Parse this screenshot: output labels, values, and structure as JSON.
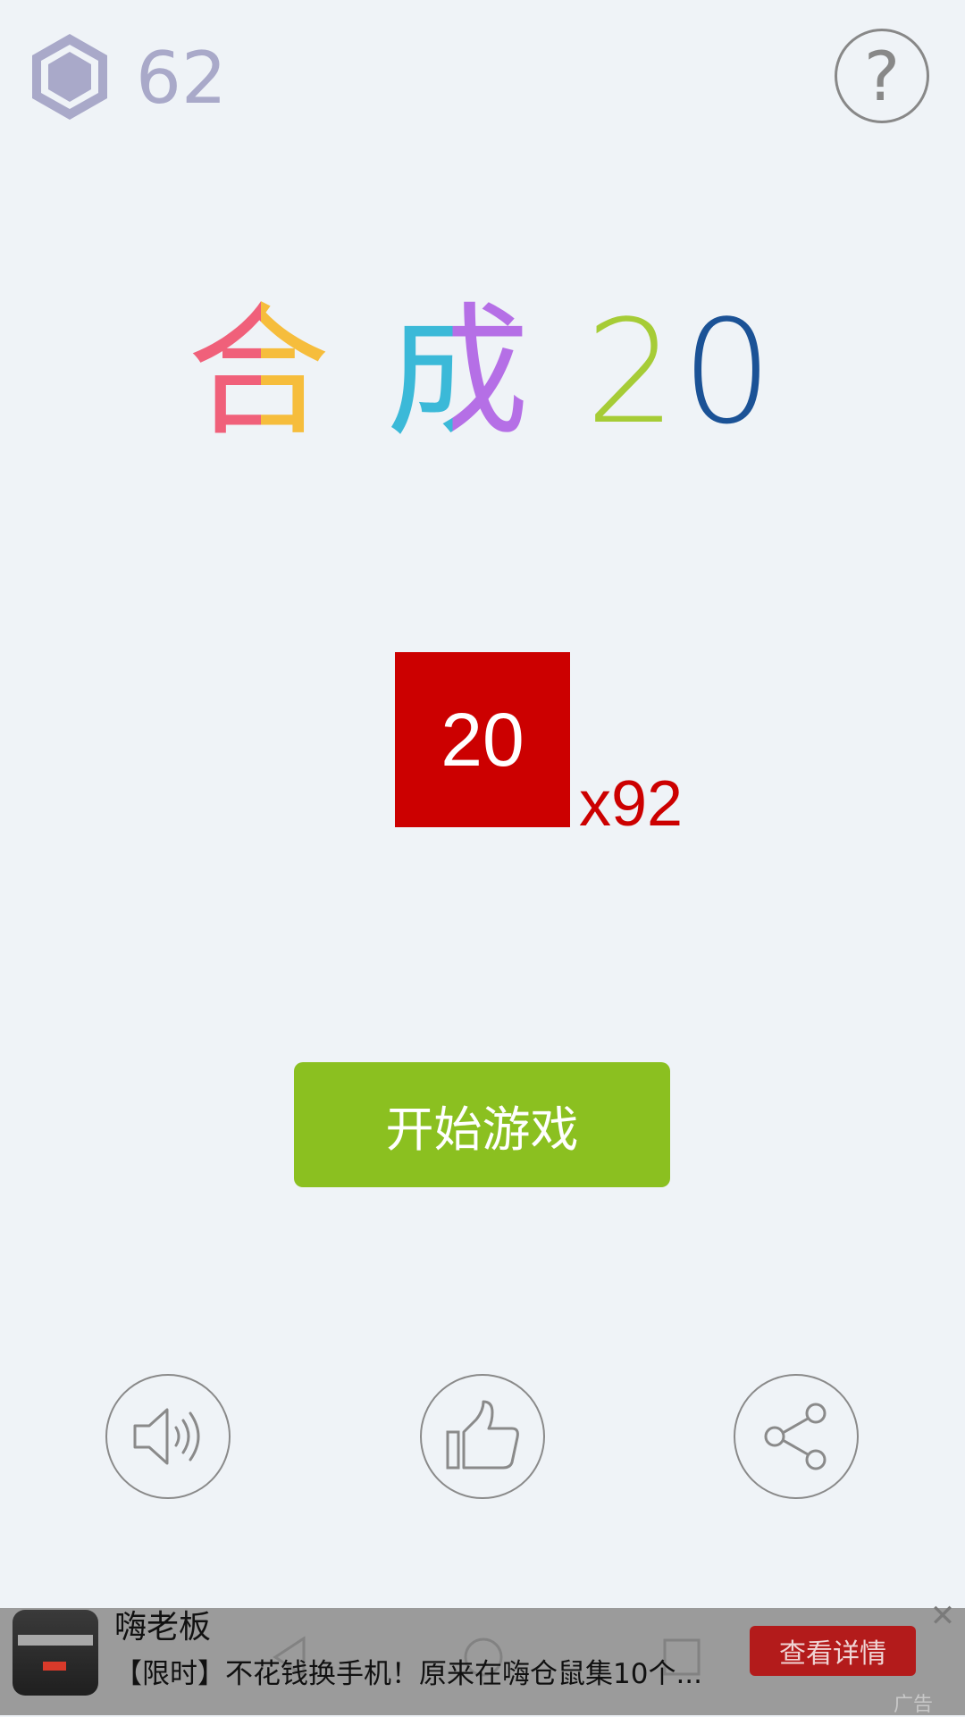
{
  "top_bar": {
    "gem_icon": "hexagon-gem-icon",
    "gem_count": "62",
    "help_label": "?"
  },
  "title": {
    "chars": [
      "合",
      "成",
      "2",
      "0"
    ],
    "colors": {
      "he_left": "#f0607a",
      "he_right": "#f6bd3c",
      "cheng_left": "#3bb9d8",
      "cheng_right": "#b56fe6",
      "two": "#a6cc36",
      "zero": "#1b5296"
    }
  },
  "tile": {
    "value": "20",
    "multiplier": "x92",
    "color": "#cc0000"
  },
  "start_button": {
    "label": "开始游戏",
    "color": "#8bc020"
  },
  "bottom_buttons": {
    "sound_icon": "speaker-icon",
    "like_icon": "thumbs-up-icon",
    "share_icon": "share-icon"
  },
  "ad": {
    "title": "嗨老板",
    "description": "【限时】不花钱换手机！原来在嗨仓鼠集10个...",
    "cta": "查看详情",
    "close": "✕",
    "label": "广告"
  }
}
